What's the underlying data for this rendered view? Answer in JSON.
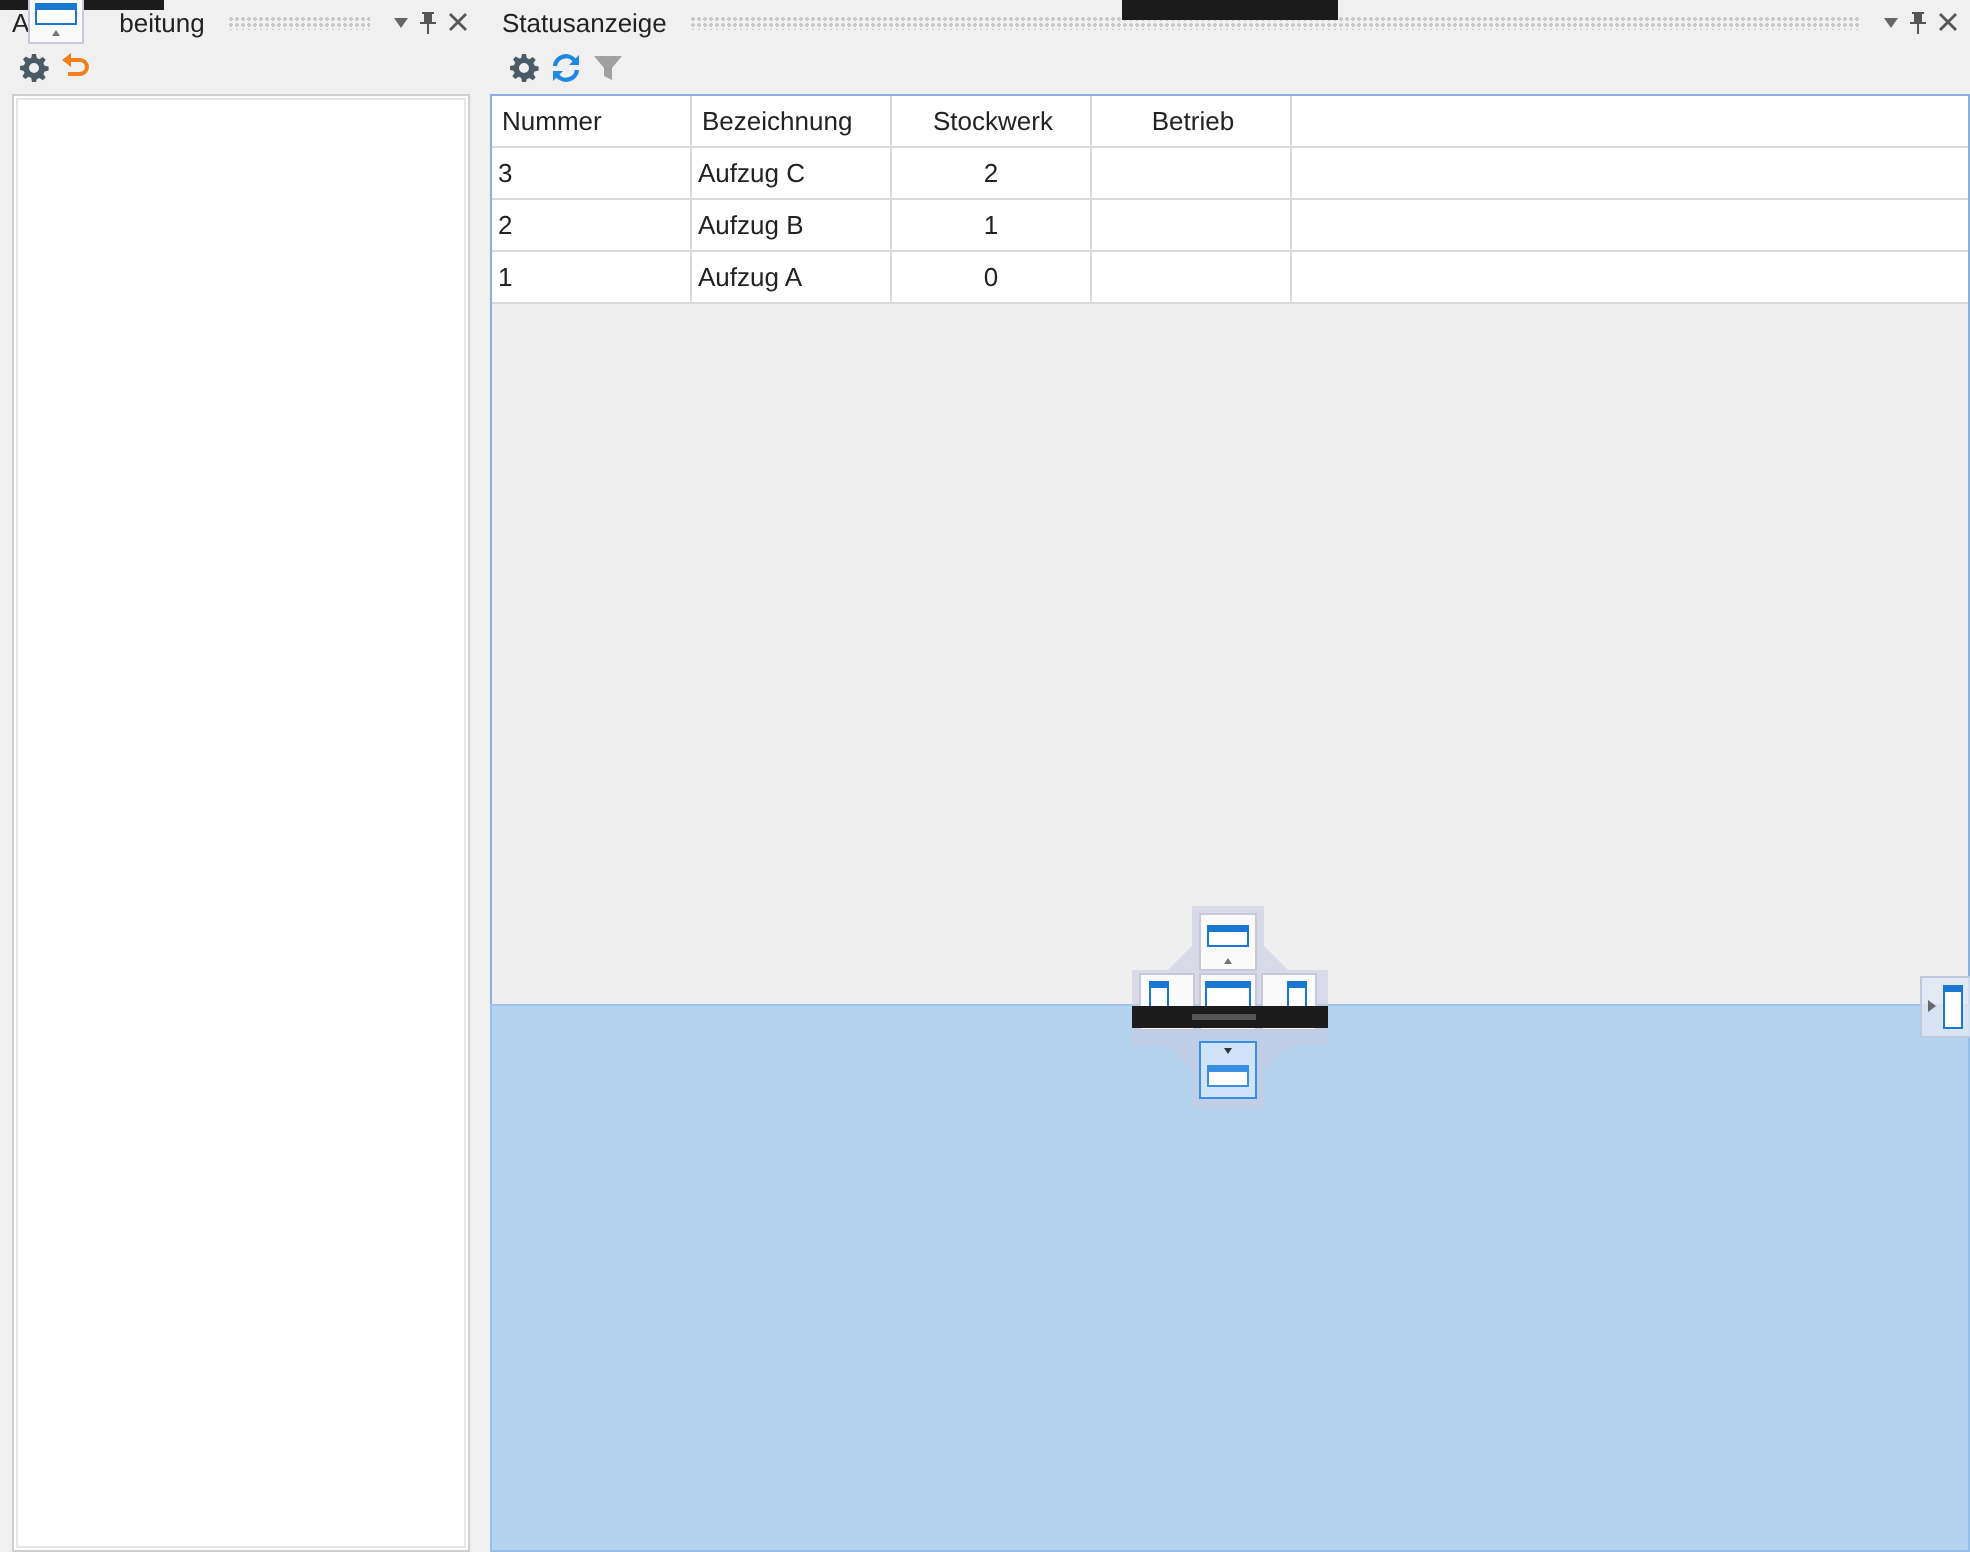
{
  "left_pane": {
    "title_start": "A",
    "title_end": "beitung",
    "toolbar": [
      {
        "kind": "settings",
        "disabled": false
      },
      {
        "kind": "undo",
        "disabled": false
      }
    ]
  },
  "right_pane": {
    "title": "Statusanzeige",
    "toolbar": [
      {
        "kind": "settings",
        "disabled": false
      },
      {
        "kind": "refresh",
        "disabled": false
      },
      {
        "kind": "filter",
        "disabled": true
      }
    ],
    "table": {
      "columns": [
        "Nummer",
        "Bezeichnung",
        "Stockwerk",
        "Betrieb"
      ],
      "rows": [
        {
          "nummer": "3",
          "bezeichnung": "Aufzug C",
          "stockwerk": "2"
        },
        {
          "nummer": "2",
          "bezeichnung": "Aufzug B",
          "stockwerk": "1"
        },
        {
          "nummer": "1",
          "bezeichnung": "Aufzug A",
          "stockwerk": "0"
        }
      ]
    }
  }
}
